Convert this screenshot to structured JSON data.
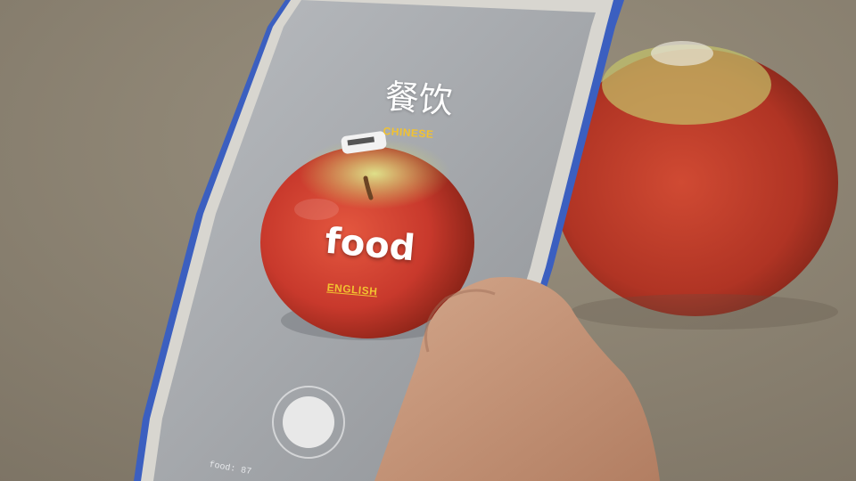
{
  "translation": {
    "target_word": "餐饮",
    "target_language": "CHINESE",
    "source_word": "food",
    "source_language": "ENGLISH"
  },
  "caption": "food: 87",
  "colors": {
    "label_accent": "#f2c230",
    "phone_case": "#3b5fc0",
    "apple_red": "#c8392c",
    "apple_green": "#c9cc6a"
  },
  "icons": {
    "shutter": "circle-shutter-icon"
  }
}
